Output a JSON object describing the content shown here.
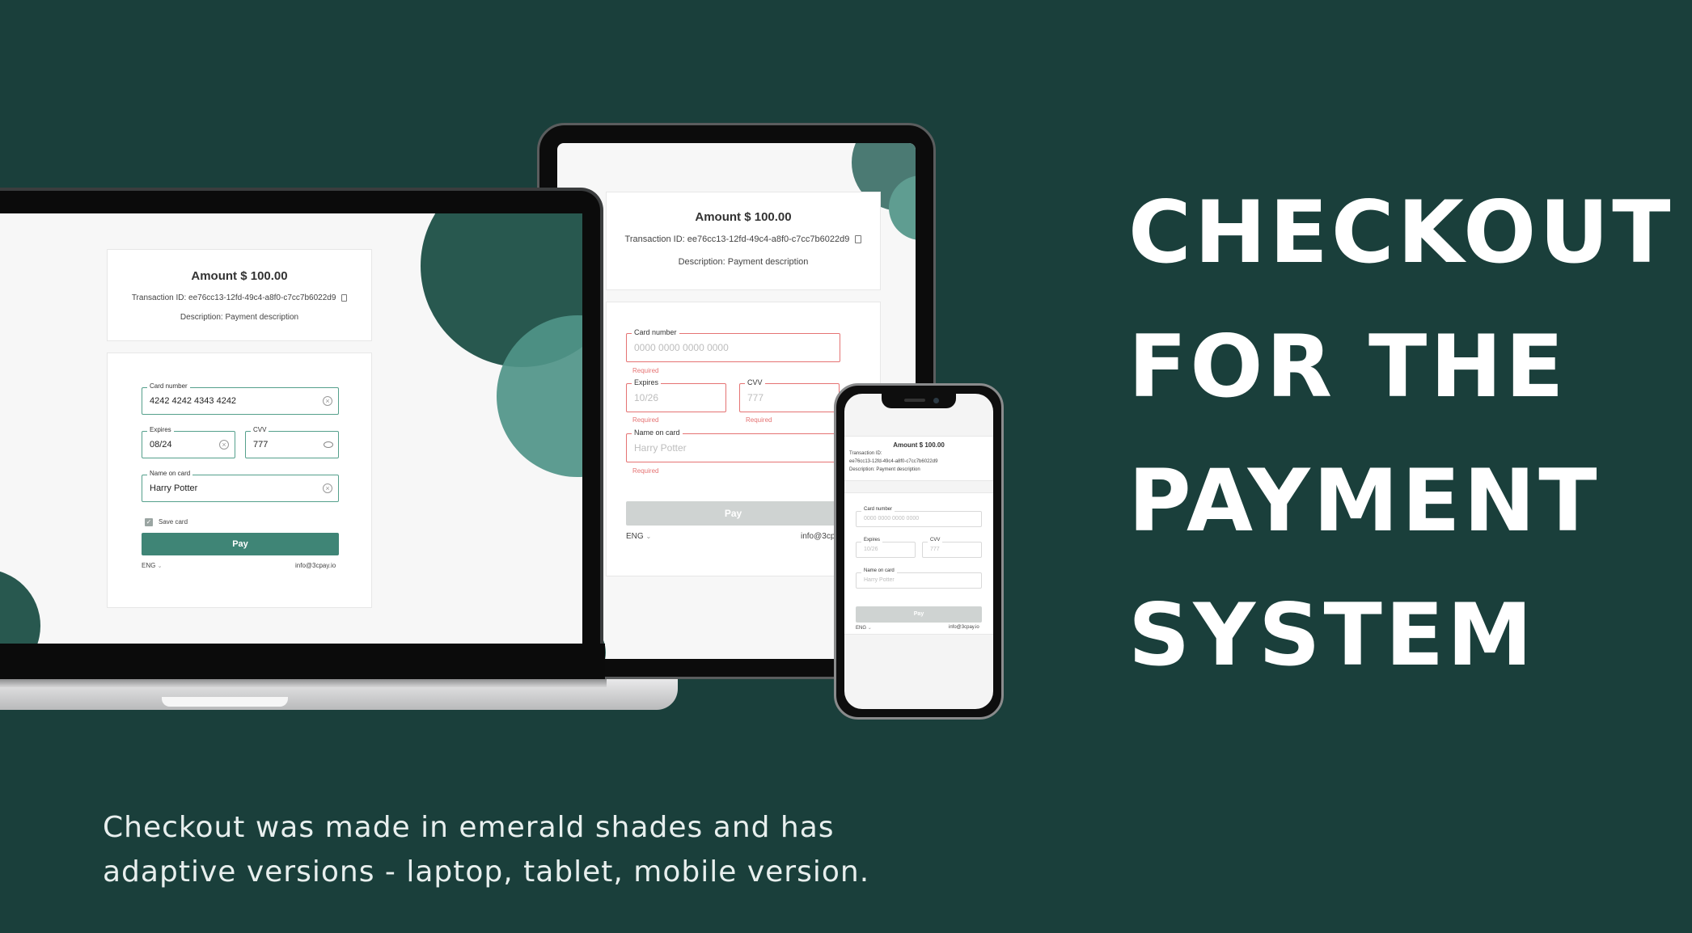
{
  "headline": {
    "line1": "CHECKOUT",
    "line2": "FOR THE",
    "line3": "PAYMENT",
    "line4": "SYSTEM"
  },
  "caption": {
    "line1": "Checkout was made in emerald shades and has",
    "line2": "adaptive versions - laptop, tablet, mobile version."
  },
  "colors": {
    "background": "#1a3f3b",
    "accent": "#3f8576",
    "circle_dark": "#28584f",
    "circle_light": "#4f9488",
    "error": "#e57373"
  },
  "laptop": {
    "amount": "Amount $ 100.00",
    "transaction": "Transaction ID: ee76cc13-12fd-49c4-a8f0-c7cc7b6022d9",
    "description": "Description: Payment description",
    "card_number_label": "Card number",
    "card_number_value": "4242 4242 4343 4242",
    "expires_label": "Expires",
    "expires_value": "08/24",
    "cvv_label": "CVV",
    "cvv_value": "777",
    "name_label": "Name on card",
    "name_value": "Harry Potter",
    "save_card_label": "Save card",
    "pay_label": "Pay",
    "language": "ENG",
    "email": "info@3cpay.io"
  },
  "tablet": {
    "amount": "Amount $ 100.00",
    "transaction": "Transaction ID: ee76cc13-12fd-49c4-a8f0-c7cc7b6022d9",
    "description": "Description: Payment description",
    "card_number_label": "Card number",
    "card_number_placeholder": "0000 0000 0000 0000",
    "expires_label": "Expires",
    "expires_placeholder": "10/26",
    "cvv_label": "CVV",
    "cvv_placeholder": "777",
    "name_label": "Name on card",
    "name_placeholder": "Harry Potter",
    "required": "Required",
    "pay_label": "Pay",
    "language": "ENG",
    "email": "info@3cpa"
  },
  "phone": {
    "amount": "Amount $ 100.00",
    "transaction_label": "Transaction ID:",
    "transaction_id": "ee76cc13-12fd-49c4-a8f0-c7cc7b6022d9",
    "description": "Description: Payment description",
    "card_number_label": "Card number",
    "card_number_placeholder": "0000 0000 0000 0000",
    "expires_label": "Expires",
    "expires_placeholder": "10/26",
    "cvv_label": "CVV",
    "cvv_placeholder": "777",
    "name_label": "Name on card",
    "name_placeholder": "Harry Potter",
    "pay_label": "Pay",
    "language": "ENG",
    "email": "info@3cpay.io"
  }
}
